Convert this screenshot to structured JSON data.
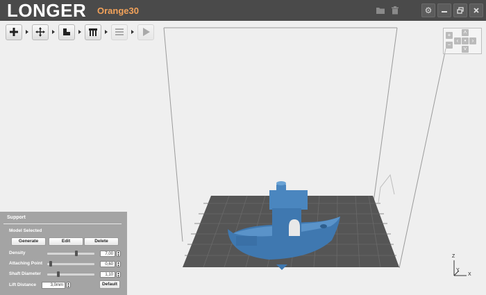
{
  "titlebar": {
    "brand": "LONGER",
    "model_name": "Orange30",
    "icons": [
      "folder-icon",
      "trash-icon",
      "gear-icon",
      "minimize-icon",
      "restore-icon",
      "close-icon"
    ],
    "win_buttons": [
      "gear",
      "minimize",
      "restore",
      "close"
    ]
  },
  "toolbar": {
    "tools": [
      "add-model-icon",
      "move-icon",
      "slice-icon",
      "support-icon",
      "layers-icon",
      "print-icon"
    ]
  },
  "colors": {
    "titlebar_bg": "#4a4a4a",
    "accent": "#f2a25a",
    "model_blue": "#3f78b0",
    "bed": "#555555",
    "panel_bg": "#9e9e9e"
  },
  "support_panel": {
    "title": "Support",
    "subtitle": "Model Selected",
    "buttons": {
      "generate": "Generate",
      "edit": "Edit",
      "delete": "Delete"
    },
    "density": {
      "label": "Density",
      "value": "7,00",
      "level": 0.62
    },
    "attaching_point": {
      "label": "Attaching Point",
      "value": "0,60",
      "level": 0.05
    },
    "shaft_diameter": {
      "label": "Shaft Diameter",
      "value": "1,10",
      "level": 0.22
    },
    "lift_distance": {
      "label": "Lift Distance",
      "value": "3,0mm"
    },
    "default_button": "Default"
  },
  "axes": {
    "z": "Z",
    "y": "Y",
    "x": "X"
  }
}
